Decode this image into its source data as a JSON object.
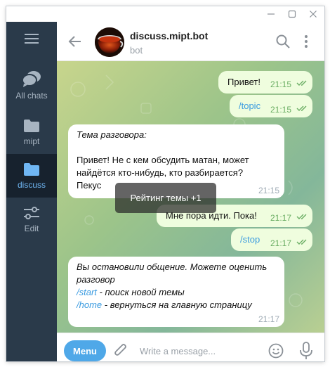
{
  "chat": {
    "title": "discuss.mipt.bot",
    "subtitle": "bot"
  },
  "sidebar": {
    "menu_icon": "hamburger-icon",
    "folders": [
      {
        "label": "All chats",
        "icon": "chat-bubbles-icon",
        "active": false
      },
      {
        "label": "mipt",
        "icon": "folder-icon",
        "active": false
      },
      {
        "label": "discuss",
        "icon": "folder-icon",
        "active": true
      },
      {
        "label": "Edit",
        "icon": "sliders-icon",
        "active": false
      }
    ]
  },
  "messages": [
    {
      "direction": "out",
      "text": "Привет!",
      "time": "21:15",
      "read": true
    },
    {
      "direction": "out",
      "text": "/topic",
      "time": "21:15",
      "read": true,
      "is_command": true
    },
    {
      "direction": "in",
      "heading": "Тема разговора:",
      "lines": [
        "Привет! Не с кем обсудить матан, может",
        "найдётся кто-нибудь, кто разбирается?",
        "Пекус"
      ],
      "time": "21:15"
    },
    {
      "direction": "out",
      "text": "Мне пора идти. Пока!",
      "time": "21:17",
      "read": true
    },
    {
      "direction": "out",
      "text": "/stop",
      "time": "21:17",
      "read": true,
      "is_command": true
    },
    {
      "direction": "in",
      "lines": [
        "Вы остановили общение. Можете оценить",
        "разговор"
      ],
      "commands": [
        {
          "cmd": "/start",
          "desc": " - поиск новой темы"
        },
        {
          "cmd": "/home",
          "desc": " - вернуться на главную страницу"
        }
      ],
      "time": "21:17"
    }
  ],
  "toast": "Рейтинг темы +1",
  "composer": {
    "menu_label": "Menu",
    "placeholder": "Write a message..."
  },
  "colors": {
    "sidebar_bg": "#2a3a4a",
    "sidebar_active_bg": "#17222e",
    "accent": "#4fa8e8",
    "outgoing_bubble": "#effdde",
    "read_ticks": "#6bae64"
  }
}
